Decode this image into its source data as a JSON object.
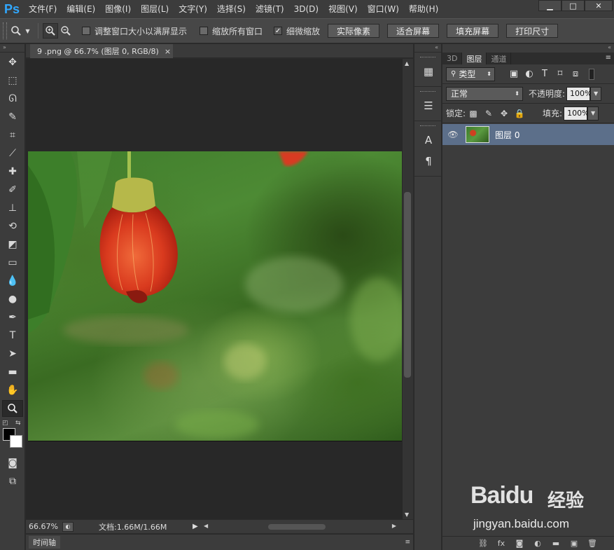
{
  "app": {
    "logo": "Ps"
  },
  "menu": [
    "文件(F)",
    "编辑(E)",
    "图像(I)",
    "图层(L)",
    "文字(Y)",
    "选择(S)",
    "滤镜(T)",
    "3D(D)",
    "视图(V)",
    "窗口(W)",
    "帮助(H)"
  ],
  "window_controls": {
    "minimize": "▁",
    "maximize": "□",
    "close": "✕"
  },
  "options": {
    "resize_windows_label": "调整窗口大小以满屏显示",
    "zoom_all_label": "缩放所有窗口",
    "scrubby_zoom_label": "细微缩放",
    "resize_windows_checked": false,
    "zoom_all_checked": false,
    "scrubby_zoom_checked": true,
    "btn_actual_pixels": "实际像素",
    "btn_fit_screen": "适合屏幕",
    "btn_fill_screen": "填充屏幕",
    "btn_print_size": "打印尺寸"
  },
  "document": {
    "tab_title": "9 .png @ 66.7% (图层 0, RGB/8)",
    "close_glyph": "×"
  },
  "status": {
    "zoom": "66.67%",
    "doc_info": "文档:1.66M/1.66M"
  },
  "timeline": {
    "tab": "时间轴"
  },
  "layers_panel": {
    "tabs": [
      "3D",
      "图层",
      "通道"
    ],
    "active_tab": "图层",
    "filter_type": "类型",
    "blend_mode": "正常",
    "opacity_label": "不透明度:",
    "opacity_value": "100%",
    "lock_label": "锁定:",
    "fill_label": "填充:",
    "fill_value": "100%",
    "layers": [
      {
        "name": "图层 0",
        "visible": true,
        "selected": true
      }
    ]
  },
  "watermark": {
    "brand": "Baidu",
    "brand_cn": "经验",
    "url": "jingyan.baidu.com"
  },
  "colors": {
    "foreground": "#000000",
    "background": "#ffffff",
    "selection": "#5c6f8a"
  }
}
